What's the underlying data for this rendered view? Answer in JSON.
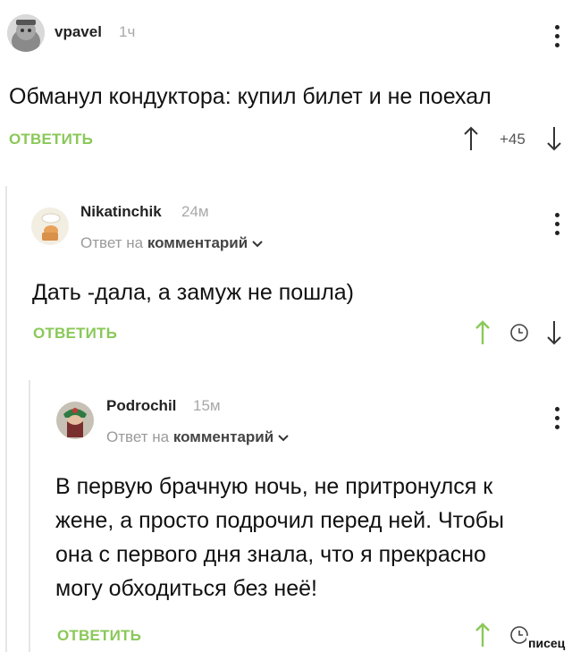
{
  "comments": [
    {
      "user": "vpavel",
      "time": "1ч",
      "text": "Обманул кондуктора: купил билет и не поехал",
      "reply_label": "ОТВЕТИТЬ",
      "rating": "+45"
    },
    {
      "user": "Nikatinchik",
      "time": "24м",
      "reply_to_prefix": "Ответ на",
      "reply_to_target": "комментарий",
      "text": "Дать -дала, а замуж не пошла)",
      "reply_label": "ОТВЕТИТЬ"
    },
    {
      "user": "Podrochil",
      "time": "15м",
      "reply_to_prefix": "Ответ на",
      "reply_to_target": "комментарий",
      "text_lines": [
        "В первую брачную ночь, не притронулся к",
        "жене, а просто подрочил перед ней. Чтобы",
        "она с первого дня знала, что я прекрасно",
        "могу обходиться без неё!"
      ],
      "reply_label": "ОТВЕТИТЬ"
    }
  ],
  "watermark": "писец",
  "colors": {
    "accent": "#8ac858",
    "text": "#111111",
    "muted": "#a9a9a9"
  }
}
